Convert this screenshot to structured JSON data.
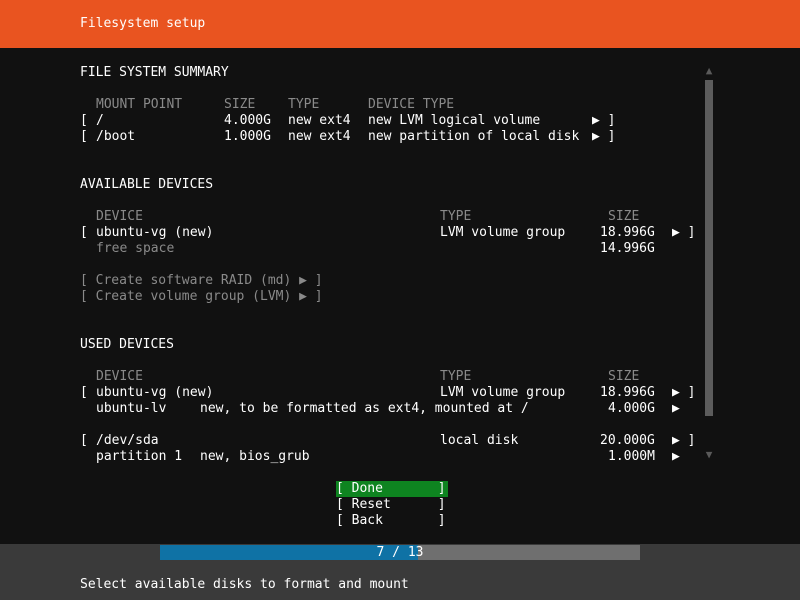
{
  "header": {
    "title": "Filesystem setup"
  },
  "summary": {
    "heading": "FILE SYSTEM SUMMARY",
    "columns": [
      "MOUNT POINT",
      "SIZE",
      "TYPE",
      "DEVICE TYPE"
    ],
    "rows": [
      {
        "open": "[",
        "mount": "/",
        "size": "4.000G",
        "type": "new ext4",
        "device_type": "new LVM logical volume",
        "arrow": "▶ ]"
      },
      {
        "open": "[",
        "mount": "/boot",
        "size": "1.000G",
        "type": "new ext4",
        "device_type": "new partition of local disk",
        "arrow": "▶ ]"
      }
    ]
  },
  "available": {
    "heading": "AVAILABLE DEVICES",
    "columns": [
      "DEVICE",
      "TYPE",
      "SIZE"
    ],
    "vg": {
      "open": "[",
      "name": "ubuntu-vg (new)",
      "type": "LVM volume group",
      "size": "18.996G",
      "arrow": "▶ ]"
    },
    "free": {
      "name": "free space",
      "size": "14.996G"
    },
    "actions": [
      "[ Create software RAID (md) ▶ ]",
      "[ Create volume group (LVM) ▶ ]"
    ]
  },
  "used": {
    "heading": "USED DEVICES",
    "columns": [
      "DEVICE",
      "TYPE",
      "SIZE"
    ],
    "vg": {
      "open": "[",
      "name": "ubuntu-vg (new)",
      "type": "LVM volume group",
      "size": "18.996G",
      "arrow": "▶ ]"
    },
    "lv": {
      "name": "ubuntu-lv",
      "desc": "new, to be formatted as ext4, mounted at /",
      "size": "4.000G",
      "arrow": "▶"
    },
    "disk": {
      "open": "[",
      "name": "/dev/sda",
      "type": "local disk",
      "size": "20.000G",
      "arrow": "▶ ]"
    },
    "part": {
      "name": "partition 1",
      "desc": "new, bios_grub",
      "size": "1.000M",
      "arrow": "▶"
    }
  },
  "scrollbar": {
    "up": "▲",
    "down": "▼"
  },
  "buttons": {
    "done": "[ Done       ]",
    "reset": "[ Reset      ]",
    "back": "[ Back       ]"
  },
  "progress": {
    "current": 7,
    "total": 13,
    "text": "7 / 13"
  },
  "footer": {
    "text": "Select available disks to format and mount"
  },
  "colors": {
    "header": "#e95420",
    "background": "#111111",
    "focus": "#0e8420",
    "progress": "#0f72a5",
    "dim": "#8a8a8a"
  }
}
